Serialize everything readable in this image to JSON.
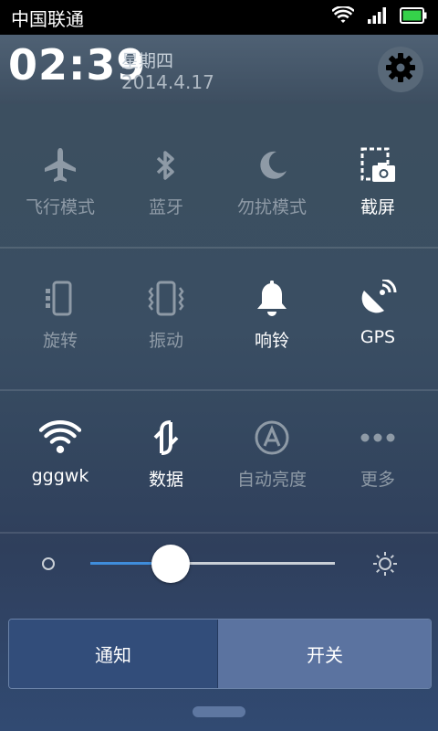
{
  "status_bar": {
    "carrier": "中国联通",
    "icons": [
      "wifi-icon",
      "signal-icon",
      "battery-icon"
    ],
    "battery_color": "#35d24a"
  },
  "header": {
    "time": "02:39",
    "weekday": "星期四",
    "date": "2014.4.17",
    "settings_icon": "gear-icon"
  },
  "toggle_rows": [
    [
      {
        "label": "飞行模式",
        "icon": "airplane-icon",
        "state": "off"
      },
      {
        "label": "蓝牙",
        "icon": "bluetooth-icon",
        "state": "off"
      },
      {
        "label": "勿扰模式",
        "icon": "moon-icon",
        "state": "off"
      },
      {
        "label": "截屏",
        "icon": "screenshot-icon",
        "state": "on"
      }
    ],
    [
      {
        "label": "旋转",
        "icon": "rotate-icon",
        "state": "off"
      },
      {
        "label": "振动",
        "icon": "vibrate-icon",
        "state": "off"
      },
      {
        "label": "响铃",
        "icon": "bell-icon",
        "state": "on"
      },
      {
        "label": "GPS",
        "icon": "gps-icon",
        "state": "on"
      }
    ],
    [
      {
        "label": "gggwk",
        "icon": "wifi-icon",
        "state": "on"
      },
      {
        "label": "数据",
        "icon": "data-sync-icon",
        "state": "on"
      },
      {
        "label": "自动亮度",
        "icon": "auto-brightness-icon",
        "state": "off"
      },
      {
        "label": "更多",
        "icon": "more-icon",
        "state": "off"
      }
    ]
  ],
  "brightness": {
    "level": 0.33,
    "min_icon": "brightness-low-icon",
    "max_icon": "brightness-high-icon",
    "fill_color": "#3f8ddb"
  },
  "tabs": [
    {
      "label": "通知",
      "selected": true
    },
    {
      "label": "开关",
      "selected": false
    }
  ]
}
